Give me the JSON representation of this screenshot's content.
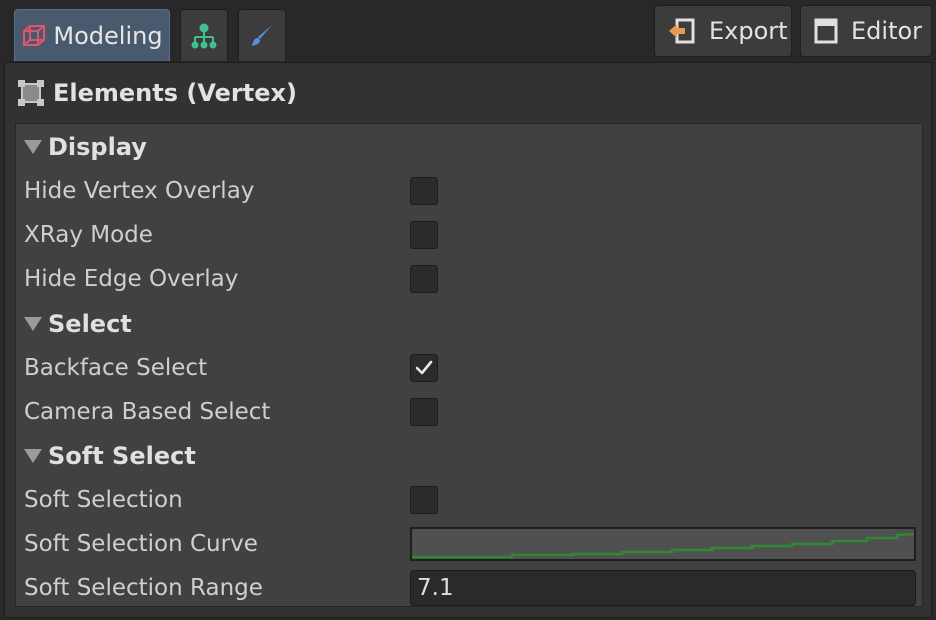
{
  "tabs": [
    {
      "label": "Modeling",
      "icon": "cube-icon",
      "active": true
    },
    {
      "icon": "hierarchy-icon",
      "active": false
    },
    {
      "icon": "brush-icon",
      "active": false
    }
  ],
  "toolbar": {
    "export_label": "Export",
    "editor_label": "Editor"
  },
  "panel": {
    "title": "Elements (Vertex)",
    "icon": "vertex-select-icon"
  },
  "sections": {
    "display": {
      "title": "Display",
      "hide_vertex_overlay": {
        "label": "Hide Vertex Overlay",
        "checked": false
      },
      "xray_mode": {
        "label": "XRay Mode",
        "checked": false
      },
      "hide_edge_overlay": {
        "label": "Hide Edge Overlay",
        "checked": false
      }
    },
    "select": {
      "title": "Select",
      "backface_select": {
        "label": "Backface Select",
        "checked": true
      },
      "camera_based_select": {
        "label": "Camera Based Select",
        "checked": false
      }
    },
    "soft_select": {
      "title": "Soft Select",
      "soft_selection": {
        "label": "Soft Selection",
        "checked": false
      },
      "soft_selection_curve": {
        "label": "Soft Selection Curve"
      },
      "soft_selection_range": {
        "label": "Soft Selection Range",
        "value": "7.1"
      }
    }
  },
  "colors": {
    "active_tab": "#4a5a6e",
    "curve_line": "#2f8a2f",
    "cube_icon": "#e0556b",
    "hierarchy_icon": "#3fc08c",
    "brush_icon": "#5a8ee0",
    "export_arrow": "#e79a52"
  }
}
